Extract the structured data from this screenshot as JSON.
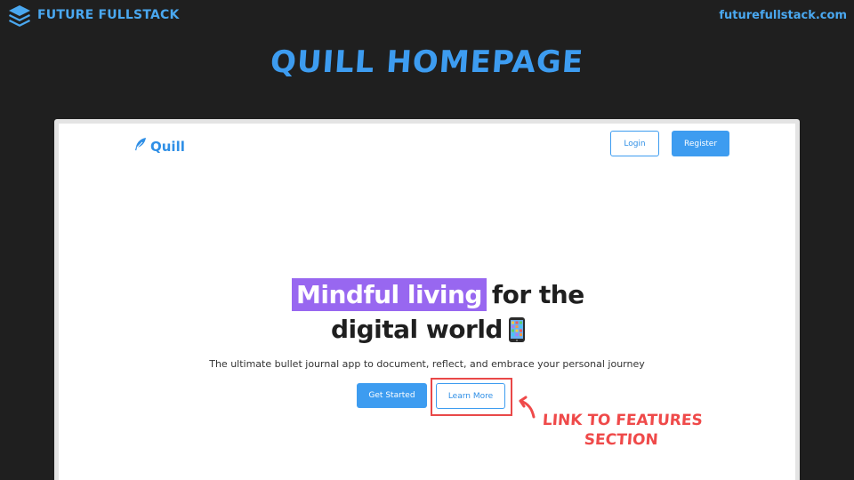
{
  "brand": {
    "name": "FUTURE FULLSTACK",
    "logo_icon": "layers-stack-icon"
  },
  "site_url": "futurefullstack.com",
  "slide_title": "QUILL HOMEPAGE",
  "quill": {
    "logo_text": "Quill",
    "logo_icon": "feather-icon",
    "nav": {
      "login_label": "Login",
      "register_label": "Register"
    },
    "hero": {
      "highlight": "Mindful living",
      "line1_rest": "for the",
      "line2": "digital world",
      "emoji_icon": "mobile-phone-icon",
      "subtitle": "The ultimate bullet journal app to document, reflect, and embrace your personal journey",
      "get_started_label": "Get Started",
      "learn_more_label": "Learn More"
    }
  },
  "annotation": {
    "text": "LINK TO FEATURES SECTION",
    "arrow_icon": "curved-arrow-icon"
  },
  "colors": {
    "background": "#1f1f1f",
    "accent": "#3d9cf0",
    "highlight": "#9867f0",
    "annotation": "#ef4a4a"
  }
}
